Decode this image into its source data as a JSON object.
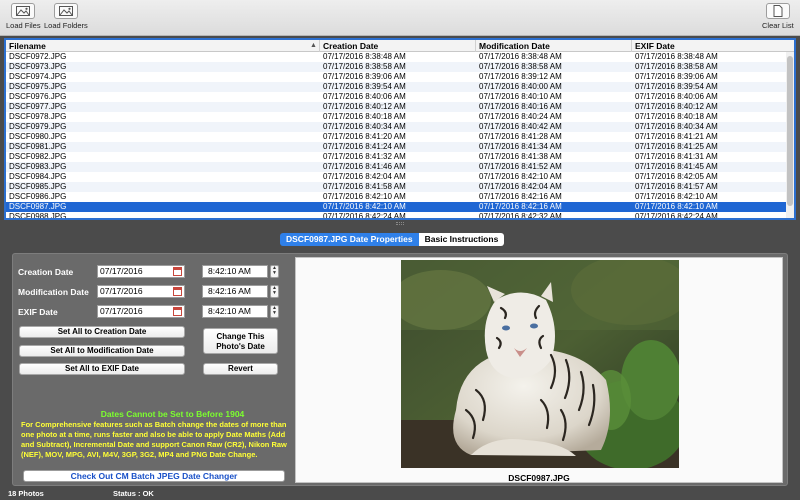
{
  "toolbar": {
    "load_files": "Load Files",
    "load_folders": "Load Folders",
    "clear_list": "Clear List"
  },
  "table": {
    "columns": [
      "Filename",
      "Creation Date",
      "Modification Date",
      "EXIF Date"
    ],
    "rows": [
      [
        "DSCF0972.JPG",
        "07/17/2016 8:38:48 AM",
        "07/17/2016 8:38:48 AM",
        "07/17/2016 8:38:48 AM"
      ],
      [
        "DSCF0973.JPG",
        "07/17/2016 8:38:58 AM",
        "07/17/2016 8:38:58 AM",
        "07/17/2016 8:38:58 AM"
      ],
      [
        "DSCF0974.JPG",
        "07/17/2016 8:39:06 AM",
        "07/17/2016 8:39:12 AM",
        "07/17/2016 8:39:06 AM"
      ],
      [
        "DSCF0975.JPG",
        "07/17/2016 8:39:54 AM",
        "07/17/2016 8:40:00 AM",
        "07/17/2016 8:39:54 AM"
      ],
      [
        "DSCF0976.JPG",
        "07/17/2016 8:40:06 AM",
        "07/17/2016 8:40:10 AM",
        "07/17/2016 8:40:06 AM"
      ],
      [
        "DSCF0977.JPG",
        "07/17/2016 8:40:12 AM",
        "07/17/2016 8:40:16 AM",
        "07/17/2016 8:40:12 AM"
      ],
      [
        "DSCF0978.JPG",
        "07/17/2016 8:40:18 AM",
        "07/17/2016 8:40:24 AM",
        "07/17/2016 8:40:18 AM"
      ],
      [
        "DSCF0979.JPG",
        "07/17/2016 8:40:34 AM",
        "07/17/2016 8:40:42 AM",
        "07/17/2016 8:40:34 AM"
      ],
      [
        "DSCF0980.JPG",
        "07/17/2016 8:41:20 AM",
        "07/17/2016 8:41:28 AM",
        "07/17/2016 8:41:21 AM"
      ],
      [
        "DSCF0981.JPG",
        "07/17/2016 8:41:24 AM",
        "07/17/2016 8:41:34 AM",
        "07/17/2016 8:41:25 AM"
      ],
      [
        "DSCF0982.JPG",
        "07/17/2016 8:41:32 AM",
        "07/17/2016 8:41:38 AM",
        "07/17/2016 8:41:31 AM"
      ],
      [
        "DSCF0983.JPG",
        "07/17/2016 8:41:46 AM",
        "07/17/2016 8:41:52 AM",
        "07/17/2016 8:41:45 AM"
      ],
      [
        "DSCF0984.JPG",
        "07/17/2016 8:42:04 AM",
        "07/17/2016 8:42:10 AM",
        "07/17/2016 8:42:05 AM"
      ],
      [
        "DSCF0985.JPG",
        "07/17/2016 8:41:58 AM",
        "07/17/2016 8:42:04 AM",
        "07/17/2016 8:41:57 AM"
      ],
      [
        "DSCF0986.JPG",
        "07/17/2016 8:42:10 AM",
        "07/17/2016 8:42:16 AM",
        "07/17/2016 8:42:10 AM"
      ],
      [
        "DSCF0987.JPG",
        "07/17/2016 8:42:10 AM",
        "07/17/2016 8:42:16 AM",
        "07/17/2016 8:42:10 AM"
      ],
      [
        "DSCF0988.JPG",
        "07/17/2016 8:42:24 AM",
        "07/17/2016 8:42:32 AM",
        "07/17/2016 8:42:24 AM"
      ]
    ],
    "selected_index": 15
  },
  "tabs": {
    "properties": "DSCF0987.JPG Date Properties",
    "instructions": "Basic Instructions"
  },
  "panel": {
    "creation_label": "Creation Date",
    "creation_date": "07/17/2016",
    "creation_time": "8:42:10 AM",
    "modification_label": "Modification Date",
    "modification_date": "07/17/2016",
    "modification_time": "8:42:16 AM",
    "exif_label": "EXIF Date",
    "exif_date": "07/17/2016",
    "exif_time": "8:42:10 AM",
    "btn_all_creation": "Set All to Creation Date",
    "btn_all_modification": "Set All to Modification Date",
    "btn_all_exif": "Set All to EXIF Date",
    "btn_change_line1": "Change This",
    "btn_change_line2": "Photo's Date",
    "btn_revert": "Revert",
    "note_title": "Dates Cannot be Set to Before 1904",
    "note_text": "For Comprehensive features such as Batch change the dates of more than one photo at a time, runs faster and also be able to apply Date Maths (Add and Subtract), Incremental Date and support Canon Raw (CR2), Nikon Raw (NEF), MOV, MPG, AVI, M4V, 3GP, 3G2, MP4 and PNG Date Change.",
    "link": "Check Out CM Batch JPEG Date Changer",
    "photo_caption": "DSCF0987.JPG"
  },
  "status": {
    "count": "18 Photos",
    "text": "Status : OK"
  },
  "colors": {
    "selection": "#1f66d3",
    "note_title": "#7cff2e",
    "note_text": "#ffff36",
    "link": "#1a51c8"
  }
}
